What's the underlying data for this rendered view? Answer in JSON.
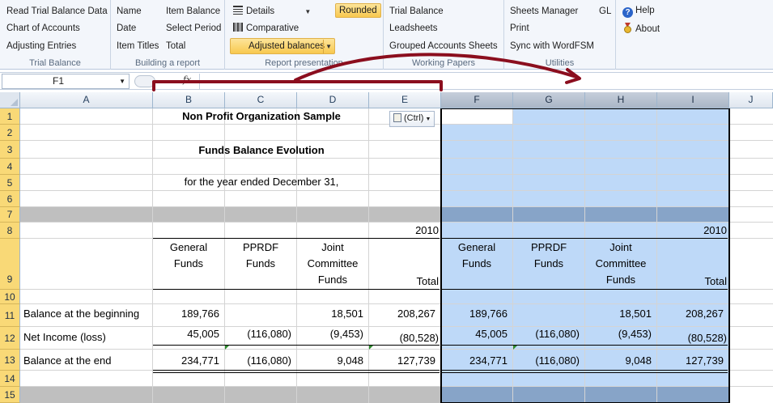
{
  "ribbon": {
    "groups": [
      {
        "label": "Trial Balance",
        "items": [
          "Read Trial Balance Data",
          "Chart of Accounts",
          "Adjusting Entries"
        ]
      },
      {
        "label": "Building a report",
        "items": [
          "Name",
          "Date",
          "Item Titles",
          "Item Balance",
          "Select Period",
          "Total"
        ]
      },
      {
        "label": "Report presentation",
        "items": [
          "Details",
          "Comparative",
          "Adjusted balances",
          "Rounded"
        ]
      },
      {
        "label": "Working Papers",
        "items": [
          "Trial Balance",
          "Leadsheets",
          "Grouped Accounts Sheets"
        ]
      },
      {
        "label": "Utilities",
        "items": [
          "Sheets Manager",
          "Print",
          "Sync with WordFSM",
          "GL"
        ]
      },
      {
        "label": "",
        "items": [
          "Help",
          "About"
        ]
      }
    ]
  },
  "formula_bar": {
    "name_box": "F1",
    "fx": "fx",
    "formula": ""
  },
  "columns": [
    "A",
    "B",
    "C",
    "D",
    "E",
    "F",
    "G",
    "H",
    "I",
    "J"
  ],
  "rows": [
    "1",
    "2",
    "3",
    "4",
    "5",
    "6",
    "7",
    "8",
    "9",
    "10",
    "11",
    "12",
    "13",
    "14",
    "15"
  ],
  "sheet": {
    "title": "Non Profit Organization Sample",
    "subtitle": "Funds Balance Evolution",
    "period": "for the year ended December 31,",
    "year": "2010",
    "paste_options": "(Ctrl)",
    "headers": {
      "general_1": "General",
      "general_2": "Funds",
      "pprdf_1": "PPRDF",
      "pprdf_2": "Funds",
      "joint_1": "Joint",
      "joint_2": "Committee",
      "joint_3": "Funds",
      "total": "Total"
    },
    "lines": [
      {
        "label": "Balance at the beginning",
        "general": "189,766",
        "pprdf": "",
        "joint": "18,501",
        "total": "208,267"
      },
      {
        "label": "Net Income (loss)",
        "general": "45,005",
        "pprdf": "(116,080)",
        "joint": "(9,453)",
        "total": "(80,528)"
      },
      {
        "label": "Balance at the end",
        "general": "234,771",
        "pprdf": "(116,080)",
        "joint": "9,048",
        "total": "127,739"
      }
    ]
  },
  "colors": {
    "selection": "#a9cbf3",
    "gray_band": "#bfbfbf",
    "annotation": "#8b0e1e",
    "highlight": "#f8c84f"
  }
}
